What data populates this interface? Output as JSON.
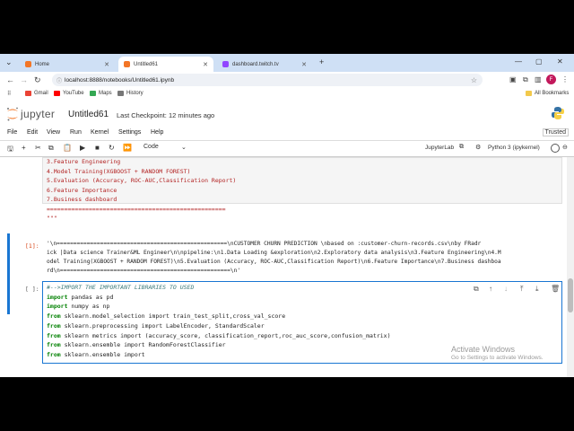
{
  "browser": {
    "tabs": [
      {
        "title": "Home",
        "favicon_color": "#f37626",
        "active": false
      },
      {
        "title": "Untitled61",
        "favicon_color": "#f37626",
        "active": true
      },
      {
        "title": "dashboard.twitch.tv",
        "favicon_color": "#9146ff",
        "active": false
      }
    ],
    "new_tab_label": "+",
    "url": "localhost:8888/notebooks/Untitled61.ipynb",
    "profile_initial": "F",
    "bookmarks": [
      {
        "label": "Gmail",
        "color": "#ea4335"
      },
      {
        "label": "YouTube",
        "color": "#ff0000"
      },
      {
        "label": "Maps",
        "color": "#34a853"
      },
      {
        "label": "History",
        "color": "#777777"
      }
    ],
    "all_bookmarks_label": "All Bookmarks"
  },
  "jupyter": {
    "logo_text": "jupyter",
    "notebook_name": "Untitled61",
    "checkpoint": "Last Checkpoint: 12 minutes ago",
    "menu": [
      "File",
      "Edit",
      "View",
      "Run",
      "Kernel",
      "Settings",
      "Help"
    ],
    "trusted": "Trusted",
    "cell_type": "Code",
    "jupyterlab_label": "JupyterLab",
    "kernel_label": "Python 3 (ipykernel)"
  },
  "cell1_lines": [
    "3.Feature Engineering",
    "4.Model Training(XGBOOST + RANDOM FOREST)",
    "5.Evaluation (Accuracy, ROC-AUC,Classification Report)",
    "6.Feature Importance",
    "7.Business dashboard",
    "===================================================",
    "\"\"\""
  ],
  "cell1_prompt": "[1]:",
  "output_lines": [
    "'\\n===================================================\\nCUSTOMER CHURN PREDICTION \\nbased on :customer-churn-records.csv\\nby FRadr",
    "ick |Data science Trainer&ML Engineer\\n\\npipeline:\\n1.Data Loading &exploration\\n2.Exploratory data analysis\\n3.Feature Engineering\\n4.M",
    "odel Training(XGBOOST + RANDOM FOREST)\\n5.Evaluation (Accuracy, ROC-AUC,Classification Report)\\n6.Feature Importance\\n7.Business dashboa",
    "rd\\n===================================================\\n'"
  ],
  "cell2_prompt": "[ ]:",
  "cell2_lines": [
    {
      "kw": "",
      "rest": "#-->IMPORT THE IMPORTANT LIBRARIES TO USED",
      "comment": true
    },
    {
      "kw": "import",
      "rest": " pandas as pd"
    },
    {
      "kw": "import",
      "rest": " numpy as np"
    },
    {
      "kw": "from",
      "rest": " sklearn.model_selection import train_test_split,cross_val_score"
    },
    {
      "kw": "from",
      "rest": " sklearn.preprocessing import LabelEncoder, StandardScaler"
    },
    {
      "kw": "from",
      "rest": " sklearn metrics import (accuracy_score, classification_report,roc_auc_score,confusion_matrix)"
    },
    {
      "kw": "from",
      "rest": " sklearn.ensemble import RandomForestClassifier"
    },
    {
      "kw": "from",
      "rest": " sklearn.ensemble import"
    }
  ],
  "watermark": {
    "title": "Activate Windows",
    "subtitle": "Go to Settings to activate Windows."
  }
}
